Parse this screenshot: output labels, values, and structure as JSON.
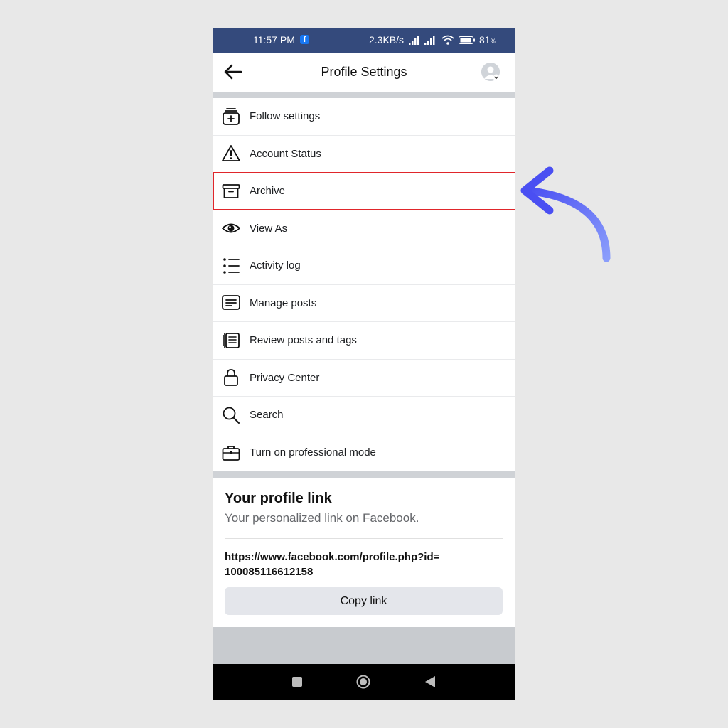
{
  "status_bar": {
    "time": "11:57 PM",
    "fb_badge": "f",
    "network_speed": "2.3KB/s",
    "battery_percent": "81",
    "battery_unit": "%"
  },
  "header": {
    "title": "Profile Settings"
  },
  "menu": {
    "items": [
      {
        "label": "Follow settings",
        "icon": "follow-settings-icon"
      },
      {
        "label": "Account Status",
        "icon": "warning-icon"
      },
      {
        "label": "Archive",
        "icon": "archive-box-icon"
      },
      {
        "label": "View As",
        "icon": "eye-icon"
      },
      {
        "label": "Activity log",
        "icon": "list-icon"
      },
      {
        "label": "Manage posts",
        "icon": "message-lines-icon"
      },
      {
        "label": "Review posts and tags",
        "icon": "review-posts-icon"
      },
      {
        "label": "Privacy Center",
        "icon": "lock-icon"
      },
      {
        "label": "Search",
        "icon": "search-icon"
      },
      {
        "label": "Turn on professional mode",
        "icon": "briefcase-icon"
      }
    ],
    "highlighted_item": "Archive"
  },
  "profile_link": {
    "title": "Your profile link",
    "subtitle": "Your personalized link on Facebook.",
    "url_line1": "https://www.facebook.com/profile.php?id=",
    "url_line2": "100085116612158",
    "copy_label": "Copy link"
  },
  "colors": {
    "status_bar": "#344a7c",
    "highlight_border": "#e0262b",
    "arrow": "#5b63f5",
    "page_background": "#e8e8e8"
  }
}
